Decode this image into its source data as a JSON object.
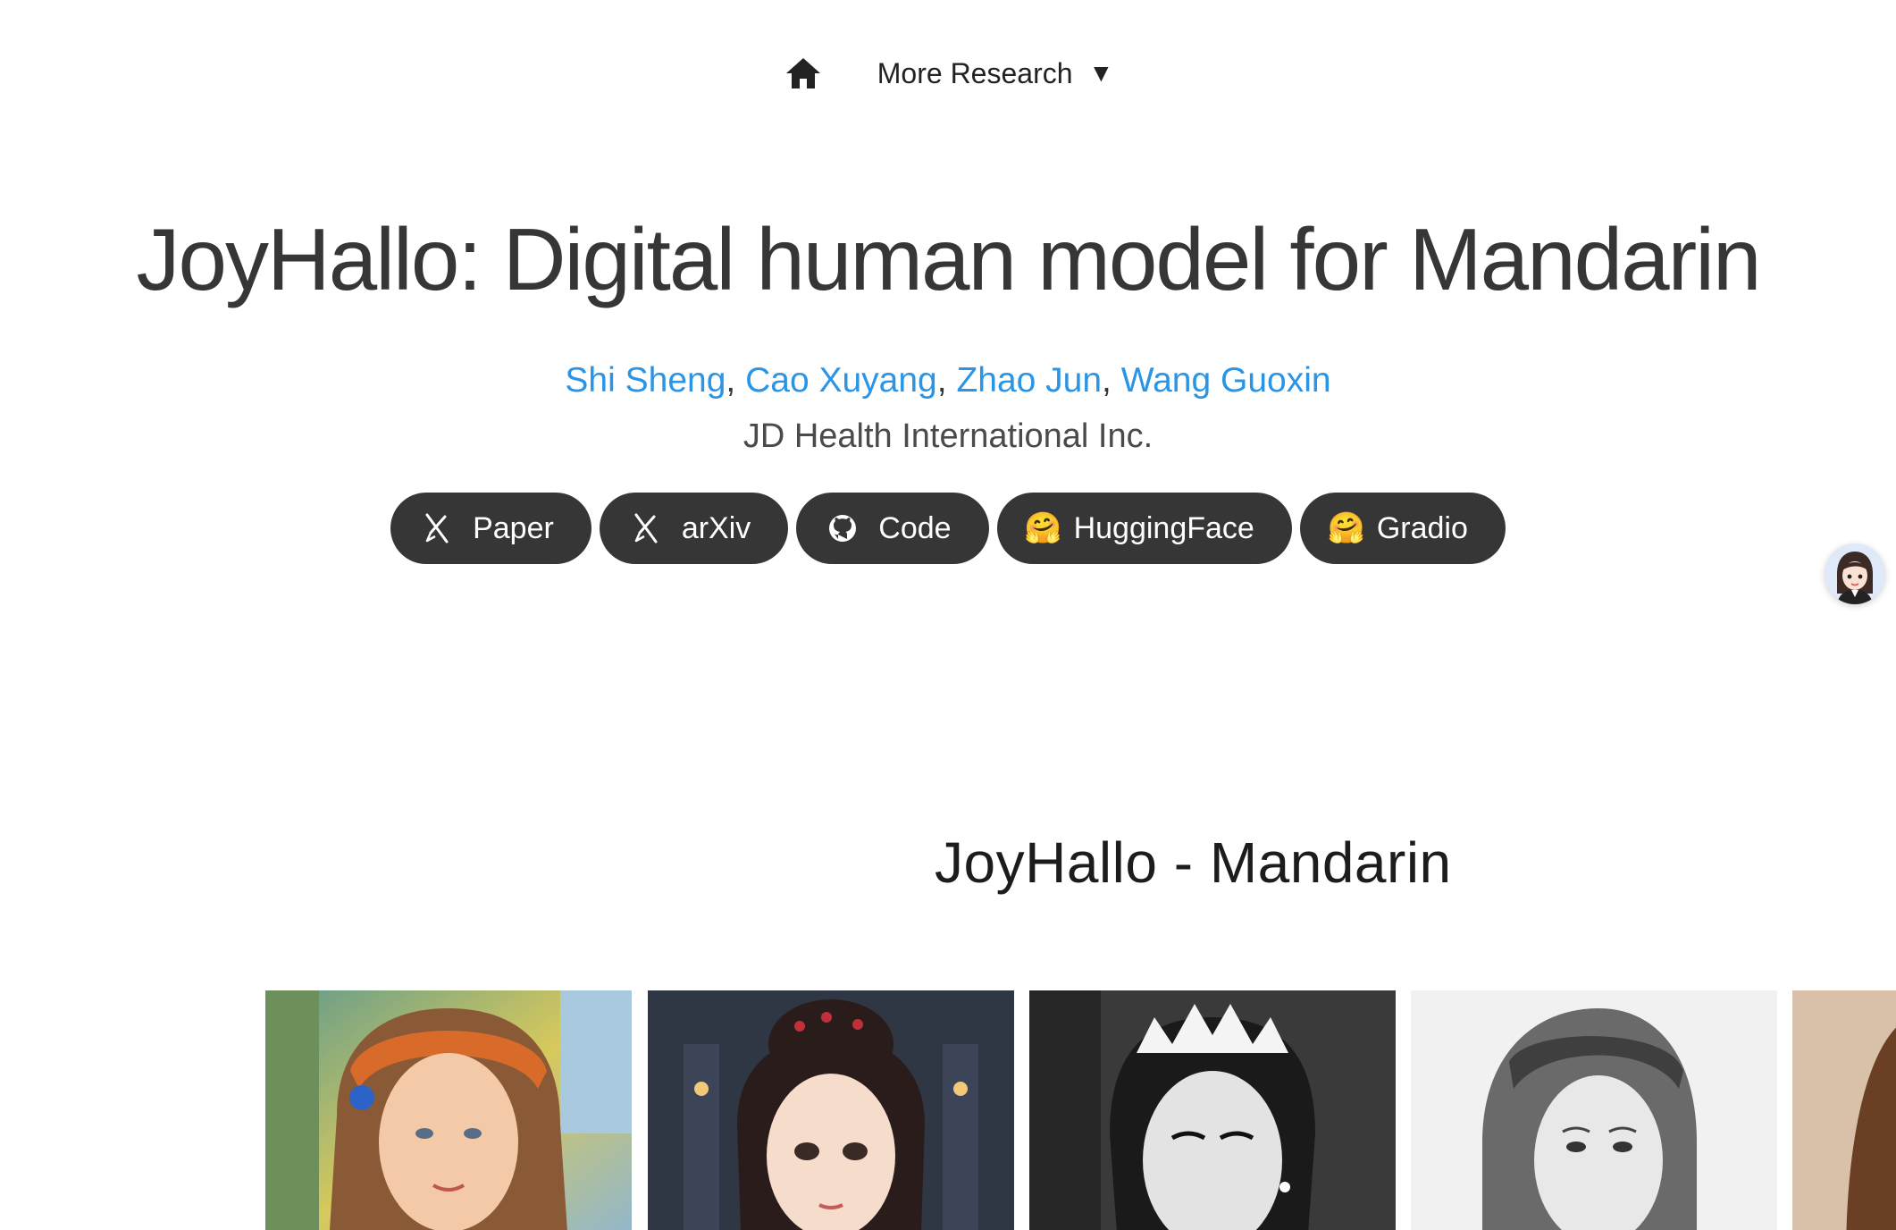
{
  "navbar": {
    "home_icon": "home-icon",
    "more_label": "More Research",
    "more_caret": "▼"
  },
  "header": {
    "title": "JoyHallo: Digital human model for Mandarin",
    "authors": [
      {
        "name": "Shi Sheng"
      },
      {
        "name": "Cao Xuyang"
      },
      {
        "name": "Zhao Jun"
      },
      {
        "name": "Wang Guoxin"
      }
    ],
    "separator": ",",
    "affiliation": "JD Health International Inc."
  },
  "links": [
    {
      "label": "Paper",
      "icon": "paper-icon"
    },
    {
      "label": "arXiv",
      "icon": "arxiv-icon"
    },
    {
      "label": "Code",
      "icon": "github-icon"
    },
    {
      "label": "HuggingFace",
      "icon": "hugging-face-emoji",
      "glyph": "🤗"
    },
    {
      "label": "Gradio",
      "icon": "hugging-face-emoji",
      "glyph": "🤗"
    }
  ],
  "assistant": {
    "icon": "assistant-avatar"
  },
  "video": {
    "heading": "JoyHallo  -  Mandarin",
    "thumbnails": [
      {
        "subject": "painted-girl-orange-headband"
      },
      {
        "subject": "animated-girl-with-hair-bun"
      },
      {
        "subject": "black-white-woman-tiara"
      },
      {
        "subject": "sketched-woman-headband"
      },
      {
        "subject": "woman-partial"
      }
    ]
  },
  "colors": {
    "text": "#363636",
    "link": "#2a95e6",
    "pill_bg": "#363636",
    "pill_text": "#ffffff"
  }
}
